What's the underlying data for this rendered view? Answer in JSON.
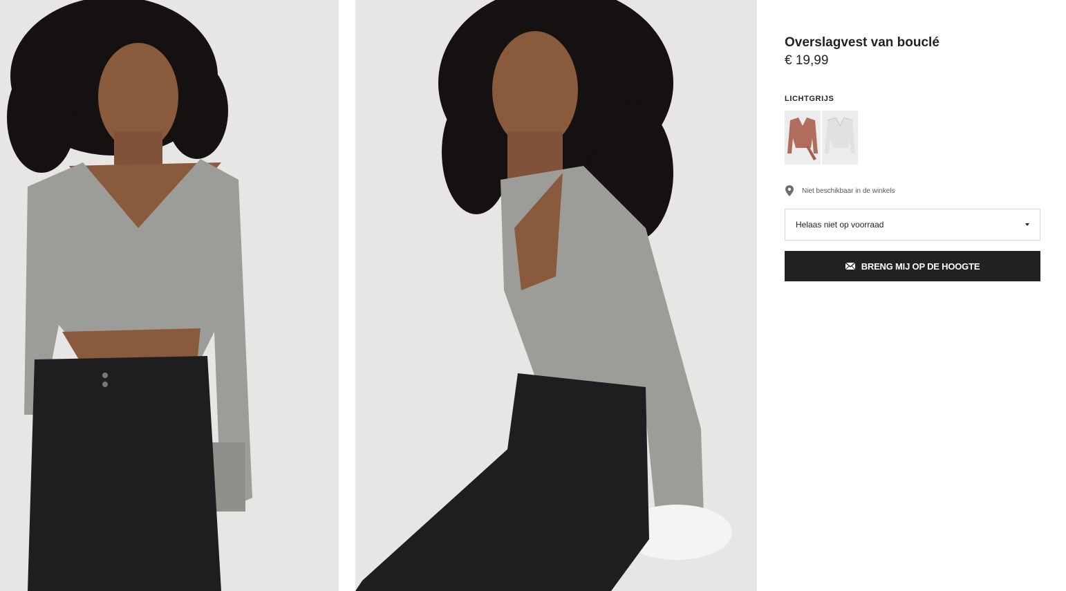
{
  "product": {
    "title": "Overslagvest van bouclé",
    "price": "€ 19,99",
    "color_label": "LICHTGRIJS"
  },
  "swatches": [
    {
      "name": "oudroze",
      "color": "#b06c5c",
      "selected": false
    },
    {
      "name": "lichtgrijs",
      "color": "#dfe2de",
      "selected": true
    }
  ],
  "store": {
    "icon": "map-pin-icon",
    "text": "Niet beschikbaar in de winkels"
  },
  "size_select": {
    "value": "Helaas niet op voorraad",
    "icon": "chevron-down-icon"
  },
  "notify_button": {
    "icon": "envelope-icon",
    "label": "BRENG MIJ OP DE HOOGTE"
  },
  "colors": {
    "sweater": "#9c9c98",
    "jeans": "#1e1e20",
    "hair": "#141110",
    "skin": "#8a5a3c",
    "background": "#e6e4e2",
    "button": "#222222"
  }
}
